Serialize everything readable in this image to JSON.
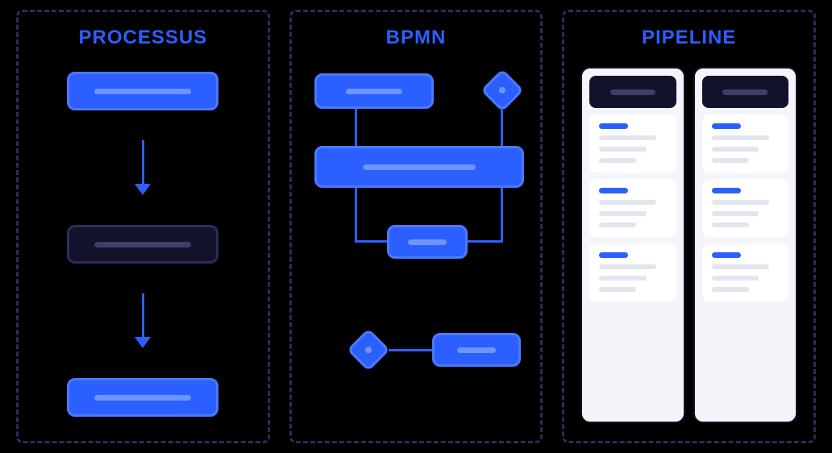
{
  "panels": {
    "processus": {
      "title": "PROCESSUS"
    },
    "bpmn": {
      "title": "BPMN"
    },
    "pipeline": {
      "title": "PIPELINE"
    }
  }
}
